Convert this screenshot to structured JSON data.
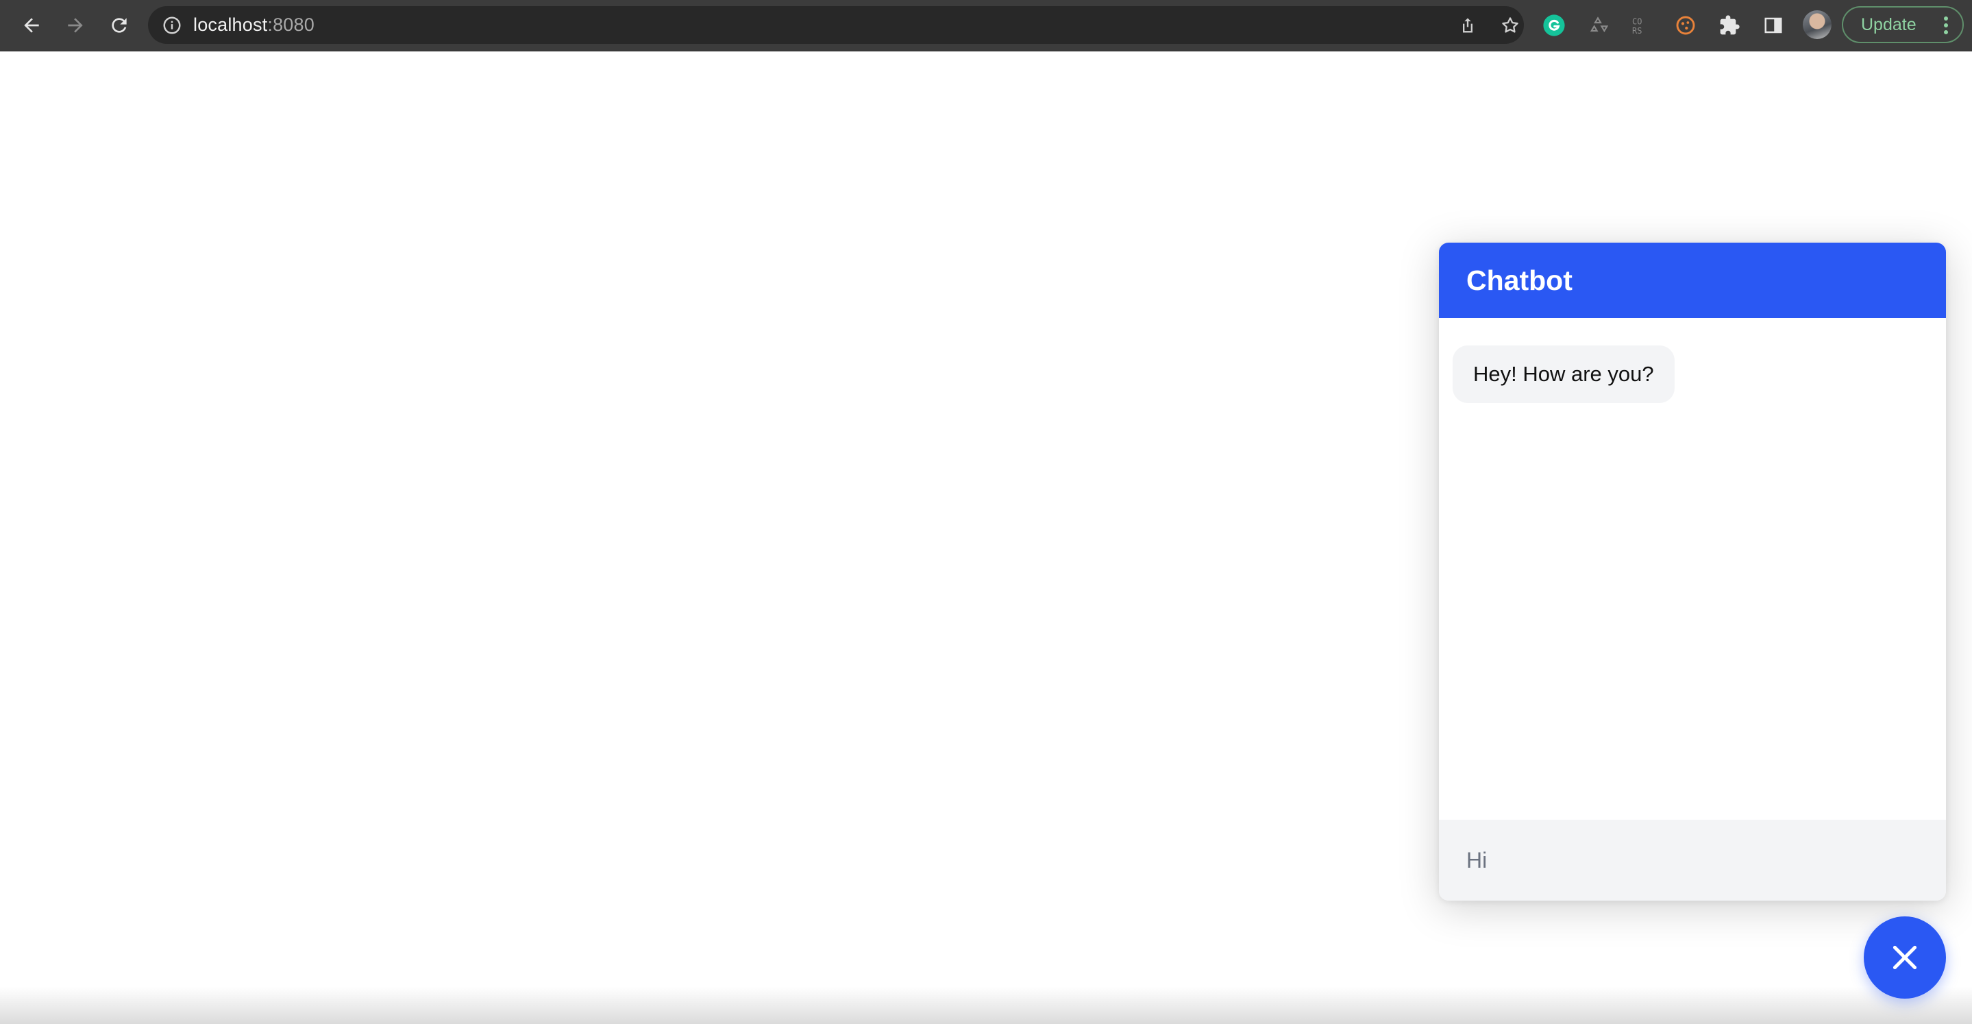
{
  "browser": {
    "url_host": "localhost",
    "url_port": ":8080",
    "update_label": "Update",
    "nav_icons": [
      "back-arrow-icon",
      "forward-arrow-icon",
      "reload-icon"
    ],
    "omnibox_icons": [
      "site-info-icon",
      "share-icon",
      "bookmark-star-icon"
    ],
    "extension_icons": [
      "grammarly-icon",
      "recycle-icon",
      "cors-icon",
      "cookie-icon",
      "puzzle-extensions-icon",
      "side-panel-icon"
    ]
  },
  "chatbot": {
    "title": "Chatbot",
    "messages": [
      {
        "from": "bot",
        "text": "Hey! How are you?"
      }
    ],
    "input_value": "Hi",
    "close_icon": "close-icon",
    "colors": {
      "accent": "#2a58f3",
      "bubble_bg": "#f3f4f6",
      "input_bg": "#f3f4f6"
    }
  }
}
